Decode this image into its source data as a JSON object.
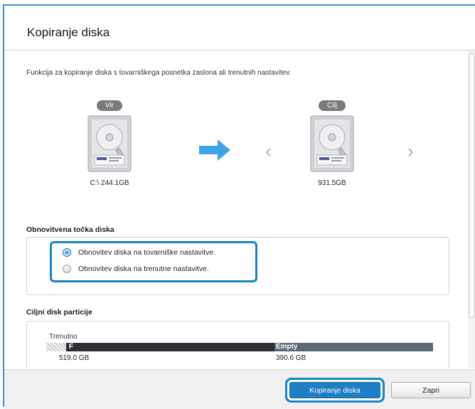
{
  "dialog": {
    "title": "Kopiranje diska",
    "description": "Funkcija za kopiranje diska s tovarniškega posnetka zaslona ali trenutnih nastavitev."
  },
  "source": {
    "label": "Vir",
    "size": "C:\\ 244.1GB"
  },
  "target": {
    "label": "Cilj",
    "size": "931.5GB"
  },
  "restore_section": {
    "title": "Obnovitvena točka diska",
    "options": [
      {
        "label": "Obnovitev diska na tovarniške nastavitve.",
        "checked": true
      },
      {
        "label": "Obnovitev diska na trenutne nastavitve.",
        "checked": false
      }
    ]
  },
  "partition_section": {
    "title": "Ciljni disk particije",
    "current_label": "Trenutno",
    "partitions": [
      {
        "name": "F",
        "size": "519.0 GB"
      },
      {
        "name": "Empty",
        "size": "390.6 GB"
      }
    ]
  },
  "buttons": {
    "copy": "Kopiranje diska",
    "close": "Zapri"
  },
  "colors": {
    "accent": "#1784c7",
    "arrow": "#3fa3e6",
    "primary_button": "#1f7ec4"
  }
}
